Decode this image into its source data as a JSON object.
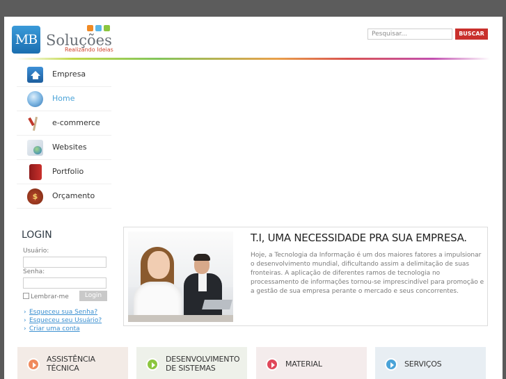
{
  "logo": {
    "mark": "MB",
    "title": "Soluções",
    "tagline": "Realizando Ideias"
  },
  "search": {
    "placeholder": "Pesquisar...",
    "button_label": "BUSCAR"
  },
  "nav": {
    "items": [
      {
        "label": "Empresa",
        "icon": "home-icon",
        "active": false
      },
      {
        "label": "Home",
        "icon": "globe-icon",
        "active": true
      },
      {
        "label": "e-commerce",
        "icon": "ecommerce-icon",
        "active": false
      },
      {
        "label": "Websites",
        "icon": "websites-icon",
        "active": false
      },
      {
        "label": "Portfolio",
        "icon": "portfolio-icon",
        "active": false
      },
      {
        "label": "Orçamento",
        "icon": "money-bag-icon",
        "active": false
      }
    ]
  },
  "login": {
    "title": "LOGIN",
    "user_label": "Usuário:",
    "password_label": "Senha:",
    "remember_label": "Lembrar-me",
    "button_label": "Login",
    "links": [
      "Esqueceu sua Senha?",
      "Esqueceu seu Usuário?",
      "Criar uma conta"
    ]
  },
  "feature": {
    "title": "T.I, UMA NECESSIDADE PRA SUA EMPRESA.",
    "text": "Hoje, a Tecnologia da Informação é um dos maiores fatores a impulsionar o desenvolvimento mundial, dificultando assim a delimitação de suas fronteiras. A aplicação de diferentes ramos de tecnologia no processamento de informações tornou-se imprescindível para promoção e a gestão de sua empresa perante o mercado e seus concorrentes."
  },
  "cards": [
    {
      "line1": "ASSISTÊNCIA",
      "line2": "TÉCNICA",
      "color": "#f08a5d"
    },
    {
      "line1": "DESENVOLVIMENTO",
      "line2": "DE SISTEMAS",
      "color": "#8cc63f"
    },
    {
      "line1": "MATERIAL",
      "line2": "",
      "color": "#e0475a"
    },
    {
      "line1": "SERVIÇOS",
      "line2": "",
      "color": "#4aa3d8"
    }
  ],
  "colors": {
    "accent": "#c9302c",
    "link": "#3a8fd0",
    "brand_blue": "#1b6fb0"
  }
}
